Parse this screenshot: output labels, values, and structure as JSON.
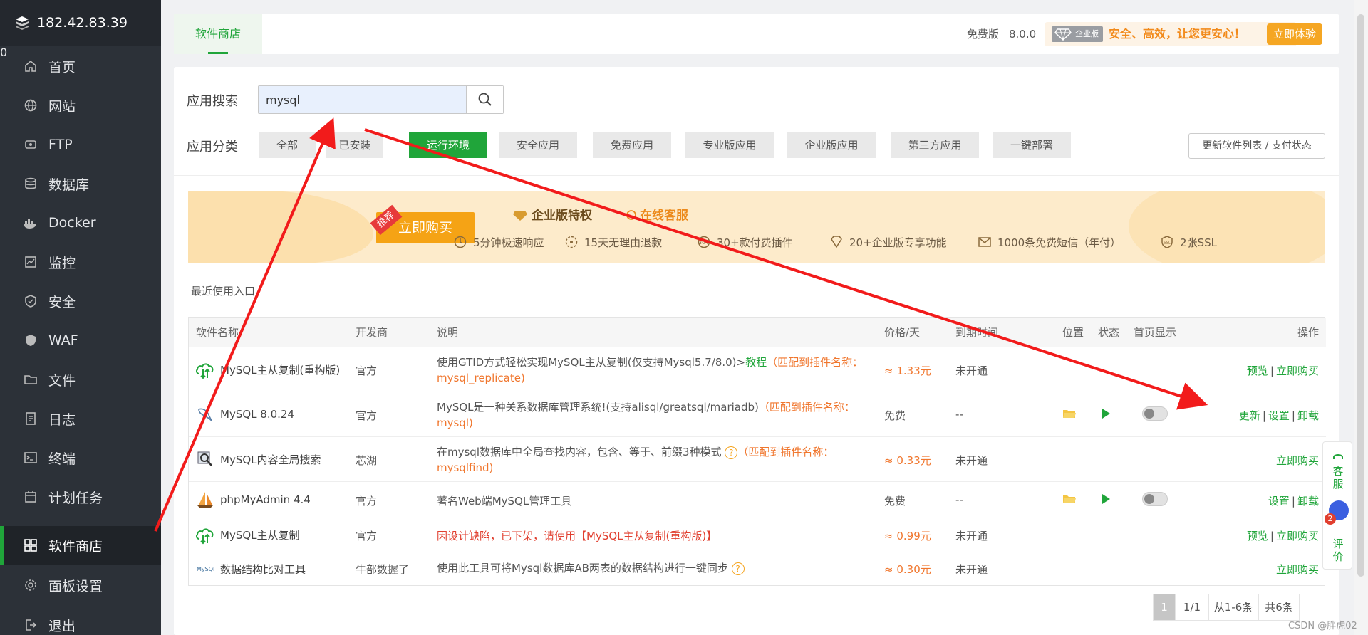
{
  "sidebar": {
    "ip": "182.42.83.39",
    "badge": "0",
    "items": [
      {
        "label": "首页",
        "icon": "home-icon"
      },
      {
        "label": "网站",
        "icon": "globe-icon"
      },
      {
        "label": "FTP",
        "icon": "ftp-icon"
      },
      {
        "label": "数据库",
        "icon": "database-icon"
      },
      {
        "label": "Docker",
        "icon": "docker-icon"
      },
      {
        "label": "监控",
        "icon": "monitor-icon"
      },
      {
        "label": "安全",
        "icon": "shield-icon"
      },
      {
        "label": "WAF",
        "icon": "waf-icon"
      },
      {
        "label": "文件",
        "icon": "folder-icon"
      },
      {
        "label": "日志",
        "icon": "log-icon"
      },
      {
        "label": "终端",
        "icon": "terminal-icon"
      },
      {
        "label": "计划任务",
        "icon": "calendar-icon"
      },
      {
        "label": "软件商店",
        "icon": "grid-icon",
        "active": true
      },
      {
        "label": "面板设置",
        "icon": "gear-icon"
      },
      {
        "label": "退出",
        "icon": "logout-icon"
      }
    ]
  },
  "topbar": {
    "tab": "软件商店",
    "version_label": "免费版",
    "version": "8.0.0",
    "enterprise_tag": "企业版",
    "slogan": "安全、高效，让您更安心！",
    "try_button": "立即体验"
  },
  "search": {
    "label": "应用搜索",
    "value": "mysql"
  },
  "categories": {
    "label": "应用分类",
    "items": [
      "全部",
      "已安装",
      "运行环境",
      "安全应用",
      "免费应用",
      "专业版应用",
      "企业版应用",
      "第三方应用",
      "一键部署"
    ],
    "active": "运行环境",
    "refresh": "更新软件列表 / 支付状态"
  },
  "banner": {
    "tag": "推荐",
    "buy": "立即购买",
    "title": "企业版特权",
    "service": "在线客服",
    "perks": [
      "5分钟极速响应",
      "15天无理由退款",
      "30+款付费插件",
      "20+企业版专享功能",
      "1000条免费短信（年付）",
      "2张SSL"
    ]
  },
  "recent_label": "最近使用入口",
  "table": {
    "headers": [
      "软件名称",
      "开发商",
      "说明",
      "价格/天",
      "到期时间",
      "位置",
      "状态",
      "首页显示",
      "操作"
    ],
    "rows": [
      {
        "name": "MySQL主从复制(重构版)",
        "vendor": "官方",
        "desc": "使用GTID方式轻松实现MySQL主从复制(仅支持Mysql5.7/8.0)>",
        "desc_link": "教程",
        "match": "（匹配到插件名称：",
        "match2": "mysql_replicate)",
        "price": "≈ 1.33元",
        "expire": "未开通",
        "actions": [
          "预览",
          "立即购买"
        ]
      },
      {
        "name": "MySQL 8.0.24",
        "vendor": "官方",
        "desc": "MySQL是一种关系数据库管理系统!(支持alisql/greatsql/mariadb)",
        "match": "（匹配到插件名称：",
        "match2": "mysql)",
        "price": "免费",
        "expire": "--",
        "actions": [
          "更新",
          "设置",
          "卸载"
        ]
      },
      {
        "name": "MySQL内容全局搜索",
        "vendor": "芯湖",
        "desc": "在mysql数据库中全局查找内容，包含、等于、前缀3种模式",
        "match": "（匹配到插件名称：",
        "match2": "mysqlfind)",
        "price": "≈ 0.33元",
        "expire": "未开通",
        "actions": [
          "立即购买"
        ]
      },
      {
        "name": "phpMyAdmin 4.4",
        "vendor": "官方",
        "desc": "著名Web端MySQL管理工具",
        "price": "免费",
        "expire": "--",
        "actions": [
          "设置",
          "卸载"
        ]
      },
      {
        "name": "MySQL主从复制",
        "vendor": "官方",
        "desc_err": "因设计缺陷，已下架，请使用【MySQL主从复制(重构版)】",
        "price": "≈ 0.99元",
        "expire": "未开通",
        "actions": [
          "预览",
          "立即购买"
        ]
      },
      {
        "name": "数据结构比对工具",
        "vendor": "牛部数握了",
        "desc": "使用此工具可将Mysql数据库AB两表的数据结构进行一键同步",
        "price": "≈ 0.30元",
        "expire": "未开通",
        "actions": [
          "立即购买"
        ]
      }
    ]
  },
  "pagination": {
    "current": "1",
    "pages": "1/1",
    "range": "从1-6条",
    "total": "共6条"
  },
  "float": {
    "service": "客服",
    "review": "评价",
    "count": "2"
  },
  "watermark": "CSDN @胖虎02",
  "colors": {
    "accent": "#20a53a",
    "sidebar": "#2c3138",
    "warning": "#f0762d",
    "arrow": "#f21b1b"
  }
}
